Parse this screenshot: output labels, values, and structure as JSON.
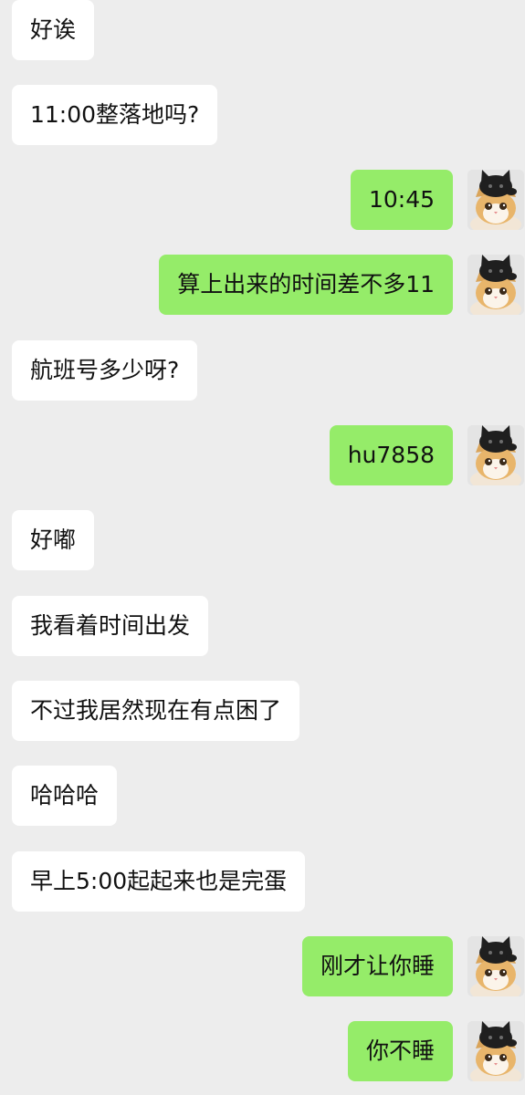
{
  "colors": {
    "background": "#ededed",
    "incoming_bubble": "#ffffff",
    "outgoing_bubble": "#95ec69",
    "text": "#111111"
  },
  "messages": [
    {
      "direction": "in",
      "text": "好诶"
    },
    {
      "direction": "in",
      "text": "11:00整落地吗?"
    },
    {
      "direction": "out",
      "text": "10:45",
      "avatar": "cat-avatar"
    },
    {
      "direction": "out",
      "text": "算上出来的时间差不多11",
      "avatar": "cat-avatar"
    },
    {
      "direction": "in",
      "text": "航班号多少呀?"
    },
    {
      "direction": "out",
      "text": "hu7858",
      "avatar": "cat-avatar"
    },
    {
      "direction": "in",
      "text": "好嘟"
    },
    {
      "direction": "in",
      "text": "我看着时间出发"
    },
    {
      "direction": "in",
      "text": "不过我居然现在有点困了"
    },
    {
      "direction": "in",
      "text": "哈哈哈"
    },
    {
      "direction": "in",
      "text": "早上5:00起起来也是完蛋"
    },
    {
      "direction": "out",
      "text": "刚才让你睡",
      "avatar": "cat-avatar"
    },
    {
      "direction": "out",
      "text": "你不睡",
      "avatar": "cat-avatar"
    }
  ]
}
